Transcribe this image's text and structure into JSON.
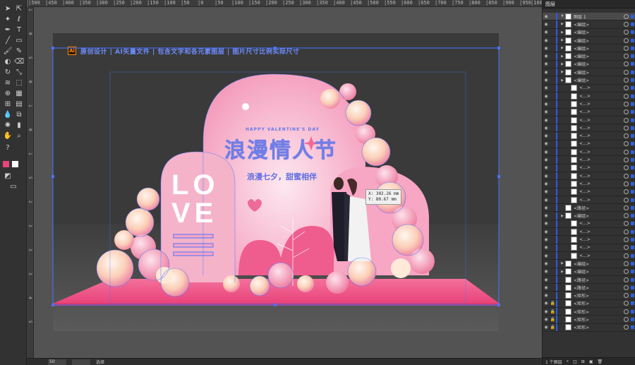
{
  "ruler_top": {
    "ticks": [
      "|500",
      "|450",
      "|400",
      "|350",
      "|300",
      "|250",
      "|200",
      "|150",
      "|100",
      "|50",
      "|0",
      "|50",
      "|100",
      "|150",
      "|200",
      "|250",
      "|300",
      "|350",
      "|400",
      "|450",
      "|500",
      "|550",
      "|600",
      "|650",
      "|700",
      "|750",
      "|800",
      "|850",
      "|900",
      "|950",
      "|100"
    ]
  },
  "ruler_left": {
    "ticks": [
      "1",
      "0",
      "5",
      "0",
      "1",
      "0",
      "1",
      "5",
      "2",
      "3",
      "3",
      "3",
      "4",
      "5"
    ]
  },
  "banner": {
    "badge": "Ai",
    "text": "原创设计 | AI矢量文件 | 包含文字和各元素图层 | 图片尺寸比例实际尺寸"
  },
  "artwork": {
    "title_en": "HAPPY VALENTINE'S DAY",
    "title_cn": "浪漫情人节",
    "subtitle_cn": "浪漫七夕，甜蜜相伴",
    "love_line1": "LO",
    "love_line1b": "VE",
    "love_line2": "VE"
  },
  "tooltip": {
    "x": "X: 302.26 mm",
    "y": "Y: 80.67 mm"
  },
  "layers_panel": {
    "tab": "图层",
    "layer_top": "图层 1",
    "rows": [
      "<编组>",
      "<编组>",
      "<编组>",
      "<编组>",
      "<编组>",
      "<编组>",
      "<编组>",
      "<编组>",
      "<...>",
      "<...>",
      "<...>",
      "<...>",
      "<...>",
      "<...>",
      "<...>",
      "<...>",
      "<...>",
      "<...>",
      "<...>",
      "<...>",
      "<...>",
      "<...>",
      "<...>",
      "<路径>",
      "<编组>",
      "<...>",
      "<...>",
      "<...>",
      "<...>",
      "<...>",
      "<编组>",
      "<编组>",
      "<路径>",
      "<路径>",
      "<矩形>",
      "<矩形>",
      "<矩形>",
      "<矩形>",
      "<矩形>"
    ],
    "footer_count": "1 个图层"
  },
  "statusbar": {
    "zoom": "50",
    "label": "选择"
  },
  "colors": {
    "selection": "#4a73ff",
    "pink_main": "#f7a6c4",
    "pink_deep": "#ef5d8e",
    "floor": "#e8437a"
  }
}
